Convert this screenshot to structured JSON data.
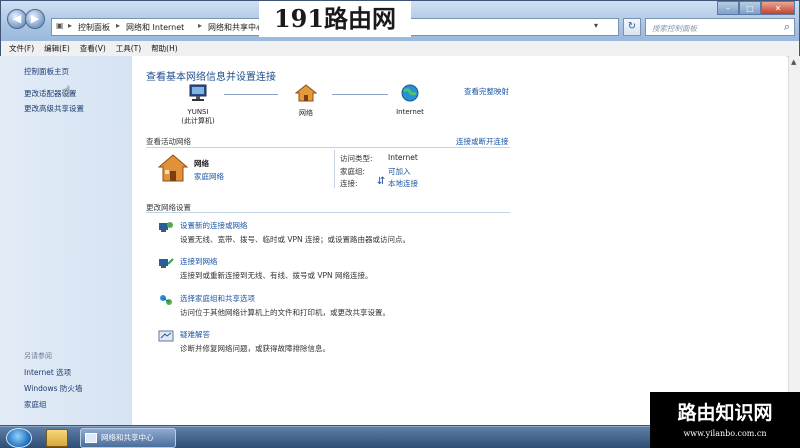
{
  "address_bar": {
    "segments": [
      "控制面板",
      "网络和 Internet",
      "网络和共享中心"
    ],
    "search_placeholder": "搜索控制面板"
  },
  "watermark_top": "191路由网",
  "menu": [
    "文件(F)",
    "编辑(E)",
    "查看(V)",
    "工具(T)",
    "帮助(H)"
  ],
  "sidebar": {
    "home": "控制面板主页",
    "items": [
      "更改适配器设置",
      "更改高级共享设置"
    ],
    "see_also_title": "另请参阅",
    "see_also": [
      "Internet 选项",
      "Windows 防火墙",
      "家庭组"
    ]
  },
  "main": {
    "heading": "查看基本网络信息并设置连接",
    "full_map": "查看完整映射",
    "map": {
      "computer": "YUNSI",
      "computer_sub": "(此计算机)",
      "network": "网络",
      "internet": "Internet"
    },
    "active_title": "查看活动网络",
    "connect_link": "连接或断开连接",
    "active": {
      "name": "网络",
      "type": "家庭网络",
      "access_label": "访问类型:",
      "access_value": "Internet",
      "homegroup_label": "家庭组:",
      "homegroup_value": "可加入",
      "connection_label": "连接:",
      "connection_value": "本地连接"
    },
    "change_title": "更改网络设置",
    "tasks": [
      {
        "title": "设置新的连接或网络",
        "desc": "设置无线、宽带、拨号、临时或 VPN 连接；或设置路由器或访问点。"
      },
      {
        "title": "连接到网络",
        "desc": "连接到或重新连接到无线、有线、拨号或 VPN 网络连接。"
      },
      {
        "title": "选择家庭组和共享选项",
        "desc": "访问位于其他网络计算机上的文件和打印机，或更改共享设置。"
      },
      {
        "title": "疑难解答",
        "desc": "诊断并修复网络问题，或获得故障排除信息。"
      }
    ]
  },
  "taskbar": {
    "task_label": "网络和共享中心"
  },
  "watermark_bottom": {
    "title": "路由知识网",
    "url": "www.yilanbo.com.cn"
  }
}
